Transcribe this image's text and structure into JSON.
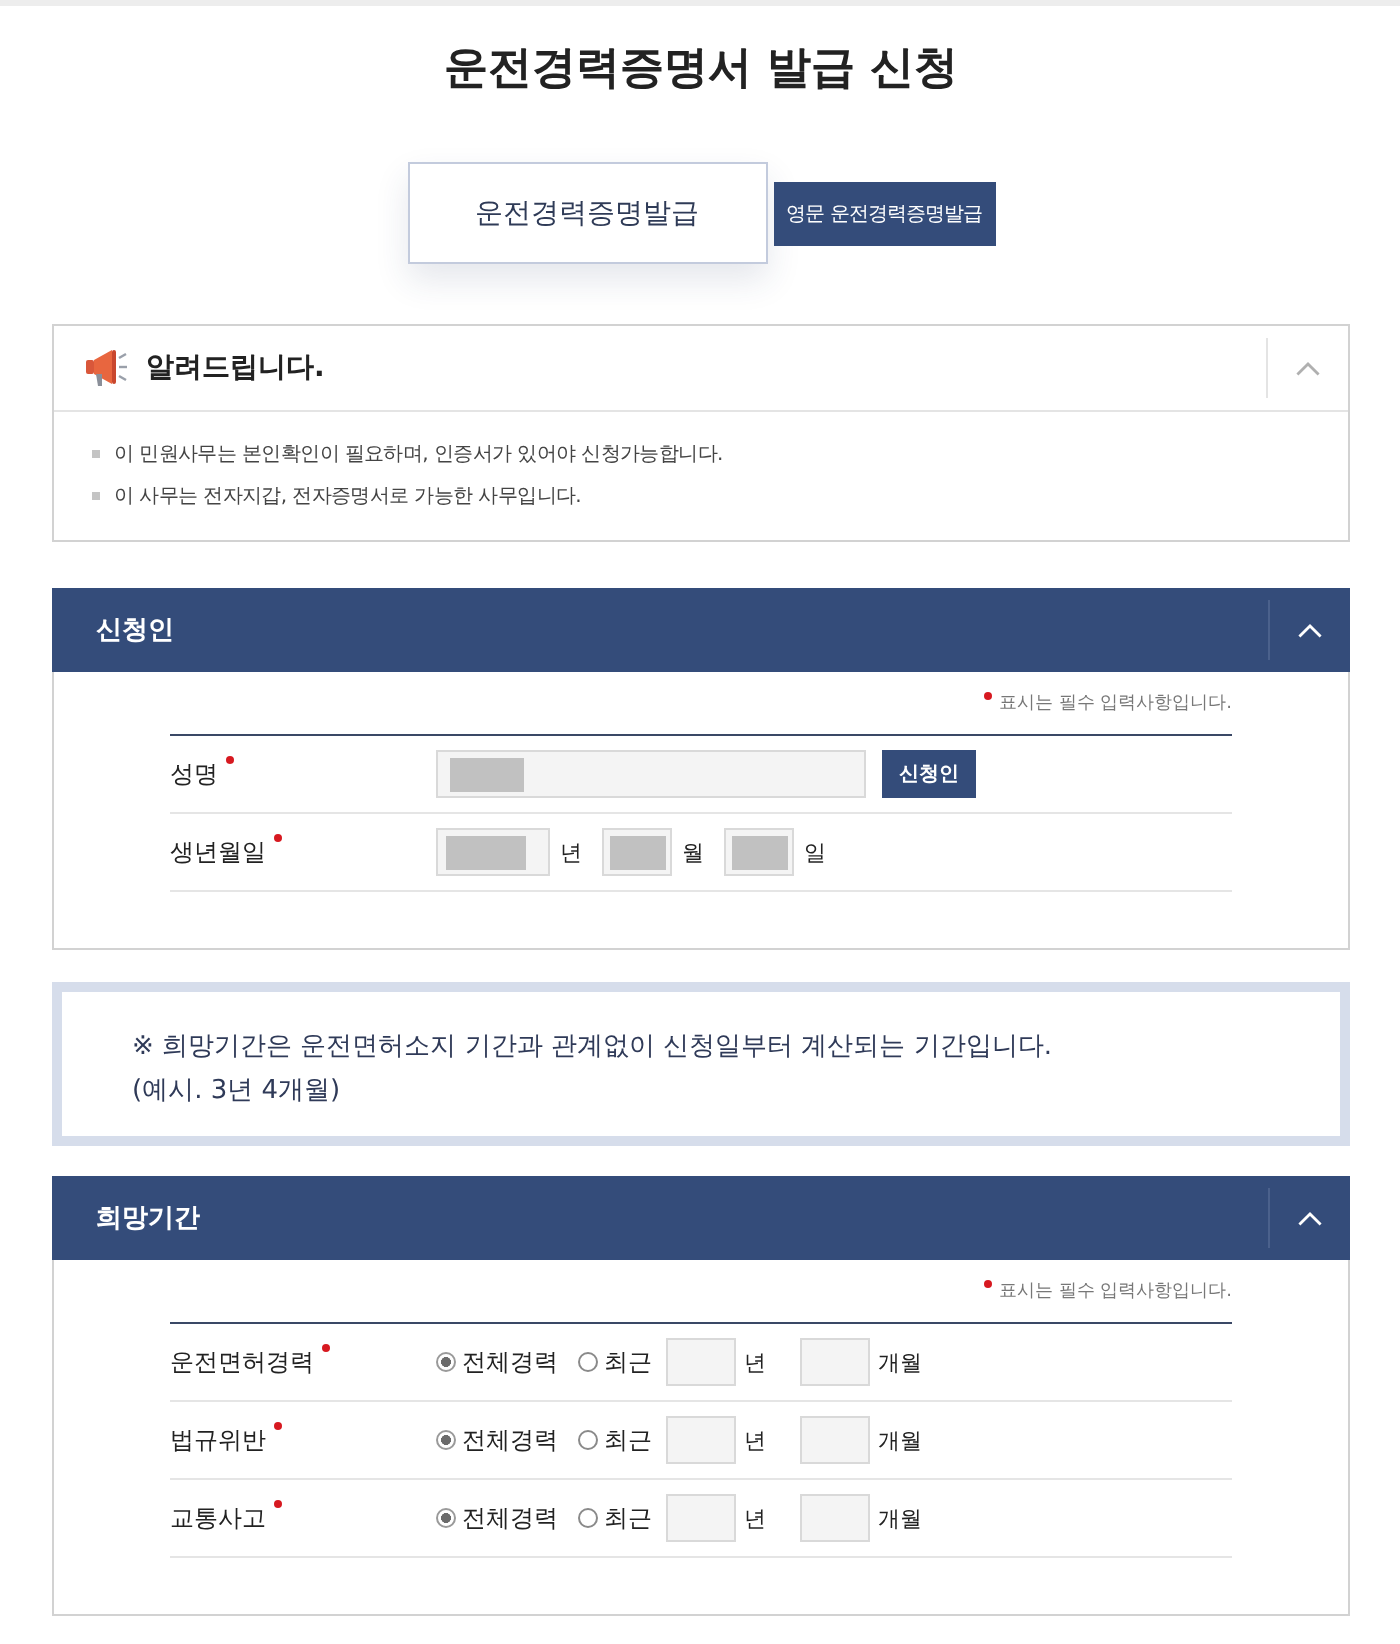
{
  "page_title": "운전경력증명서 발급 신청",
  "tabs": [
    {
      "label": "운전경력증명발급",
      "selected": true
    },
    {
      "label": "영문 운전경력증명발급",
      "selected": false
    }
  ],
  "notice": {
    "title": "알려드립니다.",
    "expanded": true,
    "items": [
      "이 민원사무는 본인확인이 필요하며, 인증서가 있어야 신청가능합니다.",
      "이 사무는 전자지갑, 전자증명서로 가능한 사무입니다."
    ]
  },
  "applicant": {
    "title": "신청인",
    "expanded": true,
    "required_note": "표시는 필수 입력사항입니다.",
    "fields": [
      {
        "kind": "text",
        "label": "성명",
        "required": true,
        "redacted": true,
        "button": "신청인"
      },
      {
        "kind": "date",
        "label": "생년월일",
        "required": true,
        "parts": [
          {
            "unit": "년",
            "redacted": true
          },
          {
            "unit": "월",
            "redacted": true
          },
          {
            "unit": "일",
            "redacted": true
          }
        ]
      }
    ]
  },
  "info": {
    "lines": [
      "※ 희망기간은 운전면허소지 기간과 관계없이 신청일부터 계산되는 기간입니다.",
      "(예시. 3년 4개월)"
    ]
  },
  "period": {
    "title": "희망기간",
    "expanded": true,
    "required_note": "표시는 필수 입력사항입니다.",
    "rows": [
      {
        "label": "운전면허경력",
        "required": true,
        "options": [
          {
            "label": "전체경력",
            "selected": true
          },
          {
            "label": "최근",
            "selected": false
          }
        ],
        "units": [
          "년",
          "개월"
        ]
      },
      {
        "label": "법규위반",
        "required": true,
        "options": [
          {
            "label": "전체경력",
            "selected": true
          },
          {
            "label": "최근",
            "selected": false
          }
        ],
        "units": [
          "년",
          "개월"
        ]
      },
      {
        "label": "교통사고",
        "required": true,
        "options": [
          {
            "label": "전체경력",
            "selected": true
          },
          {
            "label": "최근",
            "selected": false
          }
        ],
        "units": [
          "년",
          "개월"
        ]
      }
    ]
  }
}
